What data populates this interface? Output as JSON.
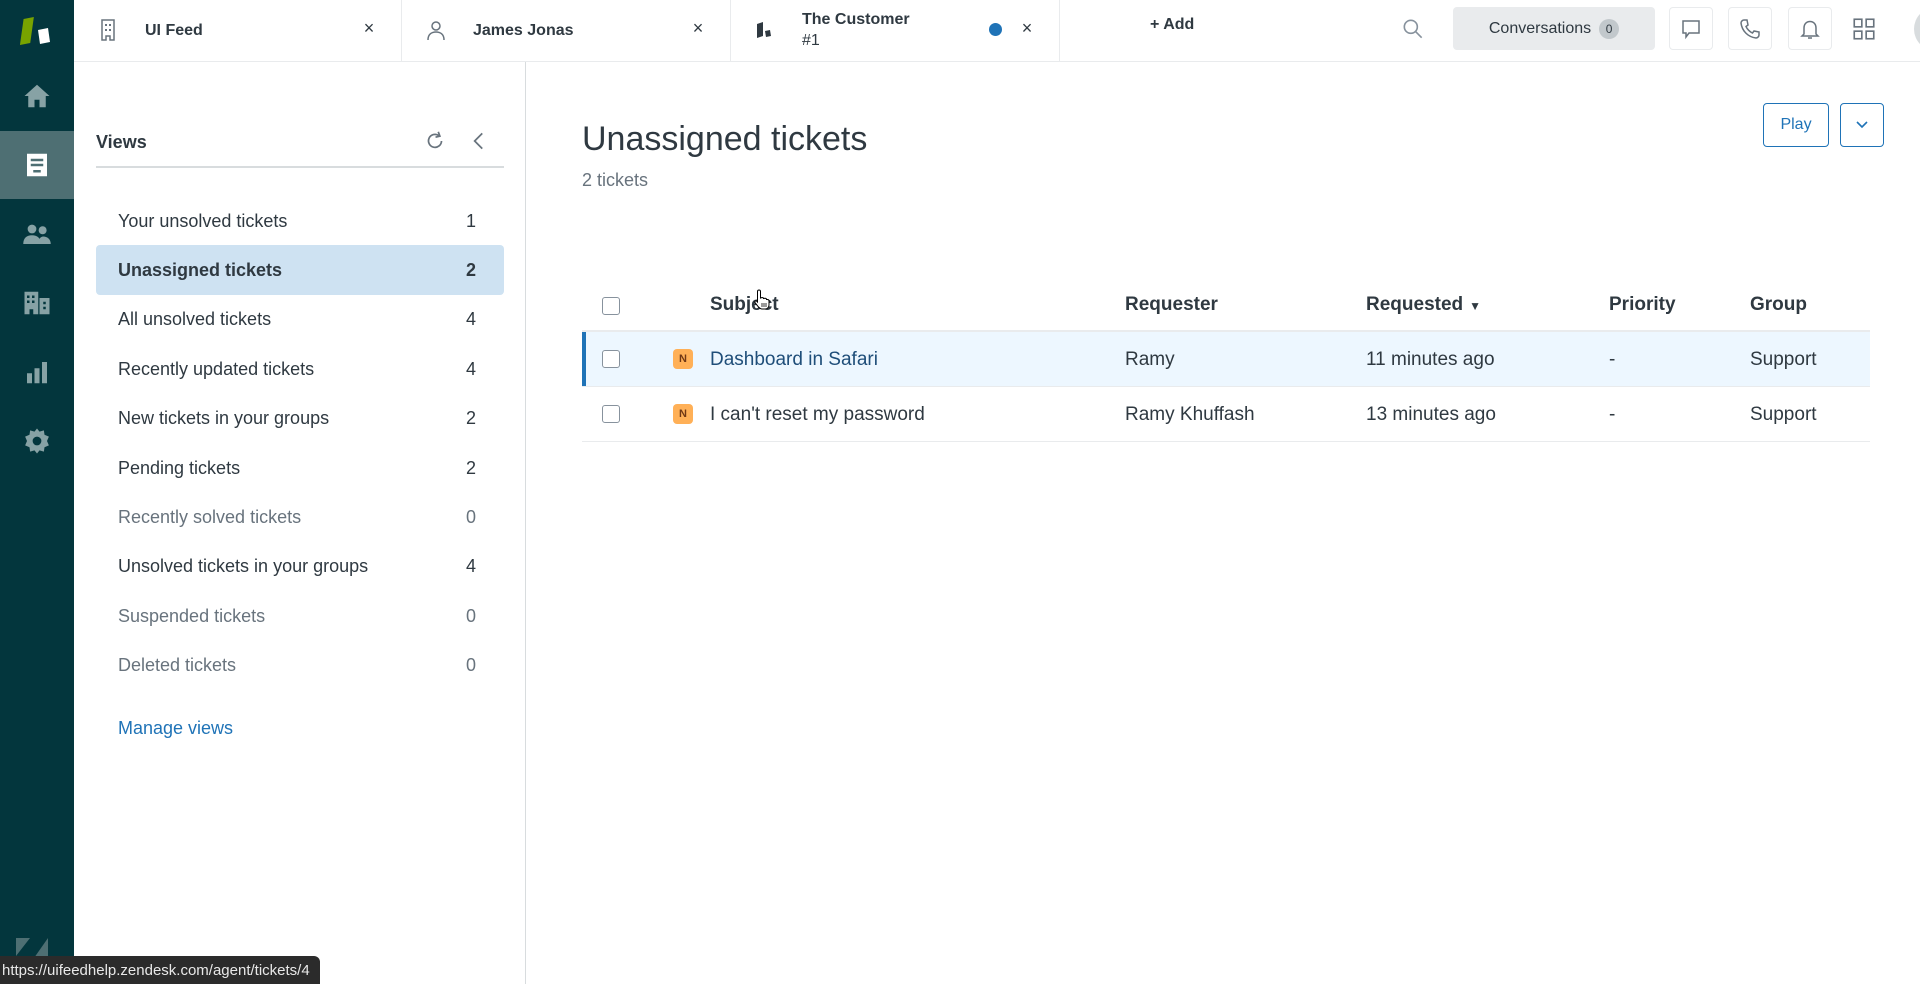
{
  "tabs": [
    {
      "label": "UI Feed",
      "icon": "building-icon",
      "close": "×"
    },
    {
      "label": "James Jonas",
      "icon": "user-icon",
      "close": "×"
    },
    {
      "label": "The Customer",
      "sublabel": "#1",
      "icon": "zendesk-org-icon",
      "close": "×",
      "unsaved_dot": true
    }
  ],
  "topbar": {
    "add_label": "+ Add",
    "conversations_label": "Conversations",
    "conversations_count": "0"
  },
  "nav": {
    "items": [
      "home",
      "views",
      "customers",
      "organizations",
      "reporting",
      "admin"
    ],
    "active": "views"
  },
  "views_panel": {
    "title": "Views",
    "items": [
      {
        "label": "Your unsolved tickets",
        "count": "1",
        "state": "normal"
      },
      {
        "label": "Unassigned tickets",
        "count": "2",
        "state": "active"
      },
      {
        "label": "All unsolved tickets",
        "count": "4",
        "state": "normal"
      },
      {
        "label": "Recently updated tickets",
        "count": "4",
        "state": "normal"
      },
      {
        "label": "New tickets in your groups",
        "count": "2",
        "state": "normal"
      },
      {
        "label": "Pending tickets",
        "count": "2",
        "state": "normal"
      },
      {
        "label": "Recently solved tickets",
        "count": "0",
        "state": "muted"
      },
      {
        "label": "Unsolved tickets in your groups",
        "count": "4",
        "state": "normal"
      },
      {
        "label": "Suspended tickets",
        "count": "0",
        "state": "muted"
      },
      {
        "label": "Deleted tickets",
        "count": "0",
        "state": "muted"
      }
    ],
    "manage_label": "Manage views"
  },
  "main": {
    "title": "Unassigned tickets",
    "count_label": "2 tickets",
    "play_label": "Play",
    "columns": {
      "subject": "Subject",
      "requester": "Requester",
      "requested": "Requested",
      "sort_indicator": "▼",
      "priority": "Priority",
      "group": "Group"
    },
    "rows": [
      {
        "status": "N",
        "subject": "Dashboard in Safari",
        "requester": "Ramy",
        "requested": "11 minutes ago",
        "priority": "-",
        "group": "Support",
        "hover": true
      },
      {
        "status": "N",
        "subject": "I can't reset my password",
        "requester": "Ramy Khuffash",
        "requested": "13 minutes ago",
        "priority": "-",
        "group": "Support",
        "hover": false
      }
    ]
  },
  "statusbar": {
    "url": "https://uifeedhelp.zendesk.com/agent/tickets/4"
  },
  "colors": {
    "rail_bg": "#03363d",
    "accent_blue": "#1f73b7",
    "active_view_bg": "#cee2f2",
    "hover_row_bg": "#edf7ff",
    "new_status": "#ffb057",
    "logo_green": "#78a300"
  }
}
